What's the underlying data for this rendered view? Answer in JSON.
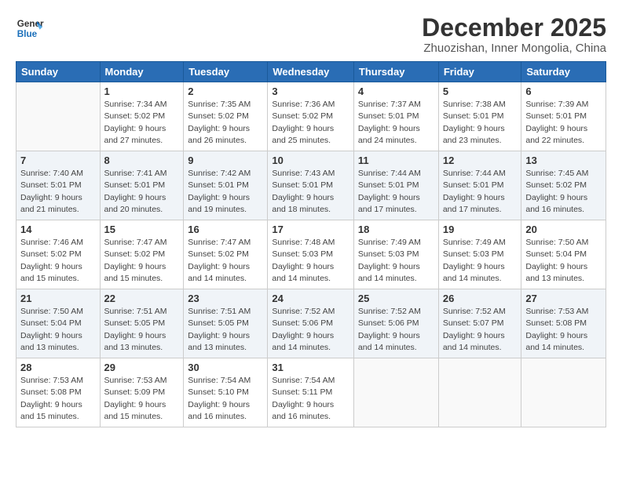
{
  "logo": {
    "line1": "General",
    "line2": "Blue"
  },
  "title": "December 2025",
  "subtitle": "Zhuozishan, Inner Mongolia, China",
  "header": {
    "days": [
      "Sunday",
      "Monday",
      "Tuesday",
      "Wednesday",
      "Thursday",
      "Friday",
      "Saturday"
    ]
  },
  "weeks": [
    {
      "shaded": false,
      "days": [
        {
          "num": "",
          "info": ""
        },
        {
          "num": "1",
          "info": "Sunrise: 7:34 AM\nSunset: 5:02 PM\nDaylight: 9 hours\nand 27 minutes."
        },
        {
          "num": "2",
          "info": "Sunrise: 7:35 AM\nSunset: 5:02 PM\nDaylight: 9 hours\nand 26 minutes."
        },
        {
          "num": "3",
          "info": "Sunrise: 7:36 AM\nSunset: 5:02 PM\nDaylight: 9 hours\nand 25 minutes."
        },
        {
          "num": "4",
          "info": "Sunrise: 7:37 AM\nSunset: 5:01 PM\nDaylight: 9 hours\nand 24 minutes."
        },
        {
          "num": "5",
          "info": "Sunrise: 7:38 AM\nSunset: 5:01 PM\nDaylight: 9 hours\nand 23 minutes."
        },
        {
          "num": "6",
          "info": "Sunrise: 7:39 AM\nSunset: 5:01 PM\nDaylight: 9 hours\nand 22 minutes."
        }
      ]
    },
    {
      "shaded": true,
      "days": [
        {
          "num": "7",
          "info": "Sunrise: 7:40 AM\nSunset: 5:01 PM\nDaylight: 9 hours\nand 21 minutes."
        },
        {
          "num": "8",
          "info": "Sunrise: 7:41 AM\nSunset: 5:01 PM\nDaylight: 9 hours\nand 20 minutes."
        },
        {
          "num": "9",
          "info": "Sunrise: 7:42 AM\nSunset: 5:01 PM\nDaylight: 9 hours\nand 19 minutes."
        },
        {
          "num": "10",
          "info": "Sunrise: 7:43 AM\nSunset: 5:01 PM\nDaylight: 9 hours\nand 18 minutes."
        },
        {
          "num": "11",
          "info": "Sunrise: 7:44 AM\nSunset: 5:01 PM\nDaylight: 9 hours\nand 17 minutes."
        },
        {
          "num": "12",
          "info": "Sunrise: 7:44 AM\nSunset: 5:01 PM\nDaylight: 9 hours\nand 17 minutes."
        },
        {
          "num": "13",
          "info": "Sunrise: 7:45 AM\nSunset: 5:02 PM\nDaylight: 9 hours\nand 16 minutes."
        }
      ]
    },
    {
      "shaded": false,
      "days": [
        {
          "num": "14",
          "info": "Sunrise: 7:46 AM\nSunset: 5:02 PM\nDaylight: 9 hours\nand 15 minutes."
        },
        {
          "num": "15",
          "info": "Sunrise: 7:47 AM\nSunset: 5:02 PM\nDaylight: 9 hours\nand 15 minutes."
        },
        {
          "num": "16",
          "info": "Sunrise: 7:47 AM\nSunset: 5:02 PM\nDaylight: 9 hours\nand 14 minutes."
        },
        {
          "num": "17",
          "info": "Sunrise: 7:48 AM\nSunset: 5:03 PM\nDaylight: 9 hours\nand 14 minutes."
        },
        {
          "num": "18",
          "info": "Sunrise: 7:49 AM\nSunset: 5:03 PM\nDaylight: 9 hours\nand 14 minutes."
        },
        {
          "num": "19",
          "info": "Sunrise: 7:49 AM\nSunset: 5:03 PM\nDaylight: 9 hours\nand 14 minutes."
        },
        {
          "num": "20",
          "info": "Sunrise: 7:50 AM\nSunset: 5:04 PM\nDaylight: 9 hours\nand 13 minutes."
        }
      ]
    },
    {
      "shaded": true,
      "days": [
        {
          "num": "21",
          "info": "Sunrise: 7:50 AM\nSunset: 5:04 PM\nDaylight: 9 hours\nand 13 minutes."
        },
        {
          "num": "22",
          "info": "Sunrise: 7:51 AM\nSunset: 5:05 PM\nDaylight: 9 hours\nand 13 minutes."
        },
        {
          "num": "23",
          "info": "Sunrise: 7:51 AM\nSunset: 5:05 PM\nDaylight: 9 hours\nand 13 minutes."
        },
        {
          "num": "24",
          "info": "Sunrise: 7:52 AM\nSunset: 5:06 PM\nDaylight: 9 hours\nand 14 minutes."
        },
        {
          "num": "25",
          "info": "Sunrise: 7:52 AM\nSunset: 5:06 PM\nDaylight: 9 hours\nand 14 minutes."
        },
        {
          "num": "26",
          "info": "Sunrise: 7:52 AM\nSunset: 5:07 PM\nDaylight: 9 hours\nand 14 minutes."
        },
        {
          "num": "27",
          "info": "Sunrise: 7:53 AM\nSunset: 5:08 PM\nDaylight: 9 hours\nand 14 minutes."
        }
      ]
    },
    {
      "shaded": false,
      "days": [
        {
          "num": "28",
          "info": "Sunrise: 7:53 AM\nSunset: 5:08 PM\nDaylight: 9 hours\nand 15 minutes."
        },
        {
          "num": "29",
          "info": "Sunrise: 7:53 AM\nSunset: 5:09 PM\nDaylight: 9 hours\nand 15 minutes."
        },
        {
          "num": "30",
          "info": "Sunrise: 7:54 AM\nSunset: 5:10 PM\nDaylight: 9 hours\nand 16 minutes."
        },
        {
          "num": "31",
          "info": "Sunrise: 7:54 AM\nSunset: 5:11 PM\nDaylight: 9 hours\nand 16 minutes."
        },
        {
          "num": "",
          "info": ""
        },
        {
          "num": "",
          "info": ""
        },
        {
          "num": "",
          "info": ""
        }
      ]
    }
  ]
}
